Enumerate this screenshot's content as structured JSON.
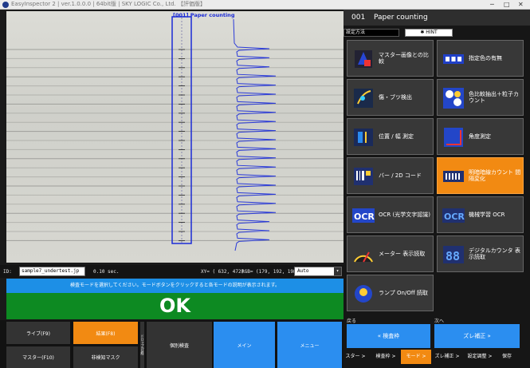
{
  "titlebar": {
    "text": "EasyInspector 2 | ver.1.0.0.0 | 64bit版 | SKY LOGIC Co., Ltd. 【評価版】",
    "minimize": "─",
    "maximize": "□",
    "close": "✕"
  },
  "viewer": {
    "overlay_label": "[001] Paper counting"
  },
  "statusbar": {
    "id_label": "ID:",
    "filename": "sample7_undertest.jp",
    "time": "0.10 sec.",
    "xy": "XY= ( 632, 472)",
    "rgb": "RGB= (179, 192, 198)",
    "zoom": "Auto"
  },
  "hint_text": "検査モードを選択してください。モードボタンをクリックすると各モードの説明が表示されます。",
  "result": "OK",
  "bottom": {
    "live": "ライブ(F9)",
    "result": "結果(F8)",
    "master": "マスター(F10)",
    "mask": "非検知マスク",
    "vertical_label": "ドロップ/日経",
    "individual": "個別検査",
    "main": "メイン",
    "menu": "メニュー"
  },
  "panel": {
    "number": "001",
    "title": "Paper counting",
    "setting_method": "設定方法",
    "hint_button": "✱ HINT",
    "modes": [
      {
        "label": "マスター画像との比較",
        "icon": "master-compare-icon"
      },
      {
        "label": "指定色の有無",
        "icon": "color-presence-icon"
      },
      {
        "label": "傷・ブツ検出",
        "icon": "scratch-detect-icon"
      },
      {
        "label": "色比較抽出＋粒子カウント",
        "icon": "particle-count-icon"
      },
      {
        "label": "位置 / 幅 測定",
        "icon": "position-width-icon"
      },
      {
        "label": "角度測定",
        "icon": "angle-icon"
      },
      {
        "label": "バー / 2D コード",
        "icon": "barcode-icon"
      },
      {
        "label": "明暗暗線カウント 間隔変化",
        "icon": "line-count-icon"
      },
      {
        "label": "OCR (光学文字認識)",
        "icon": "ocr-icon"
      },
      {
        "label": "機械学習 OCR",
        "icon": "ocr-pro-icon"
      },
      {
        "label": "メーター 表示読取",
        "icon": "meter-icon"
      },
      {
        "label": "デジタルカウンタ 表示読取",
        "icon": "digital-icon"
      },
      {
        "label": "ランプ On/Off 読取",
        "icon": "lamp-icon"
      }
    ],
    "selected_index": 7,
    "back_label": "戻る",
    "next_label": "次へ",
    "back_button": "« 検査枠",
    "next_button": "ズレ補正 »",
    "breadcrumbs": [
      "スター >",
      "検査枠 >",
      "モード >",
      "ズレ補正 >",
      "設定調整 >",
      "保存"
    ],
    "active_crumb": 2
  }
}
